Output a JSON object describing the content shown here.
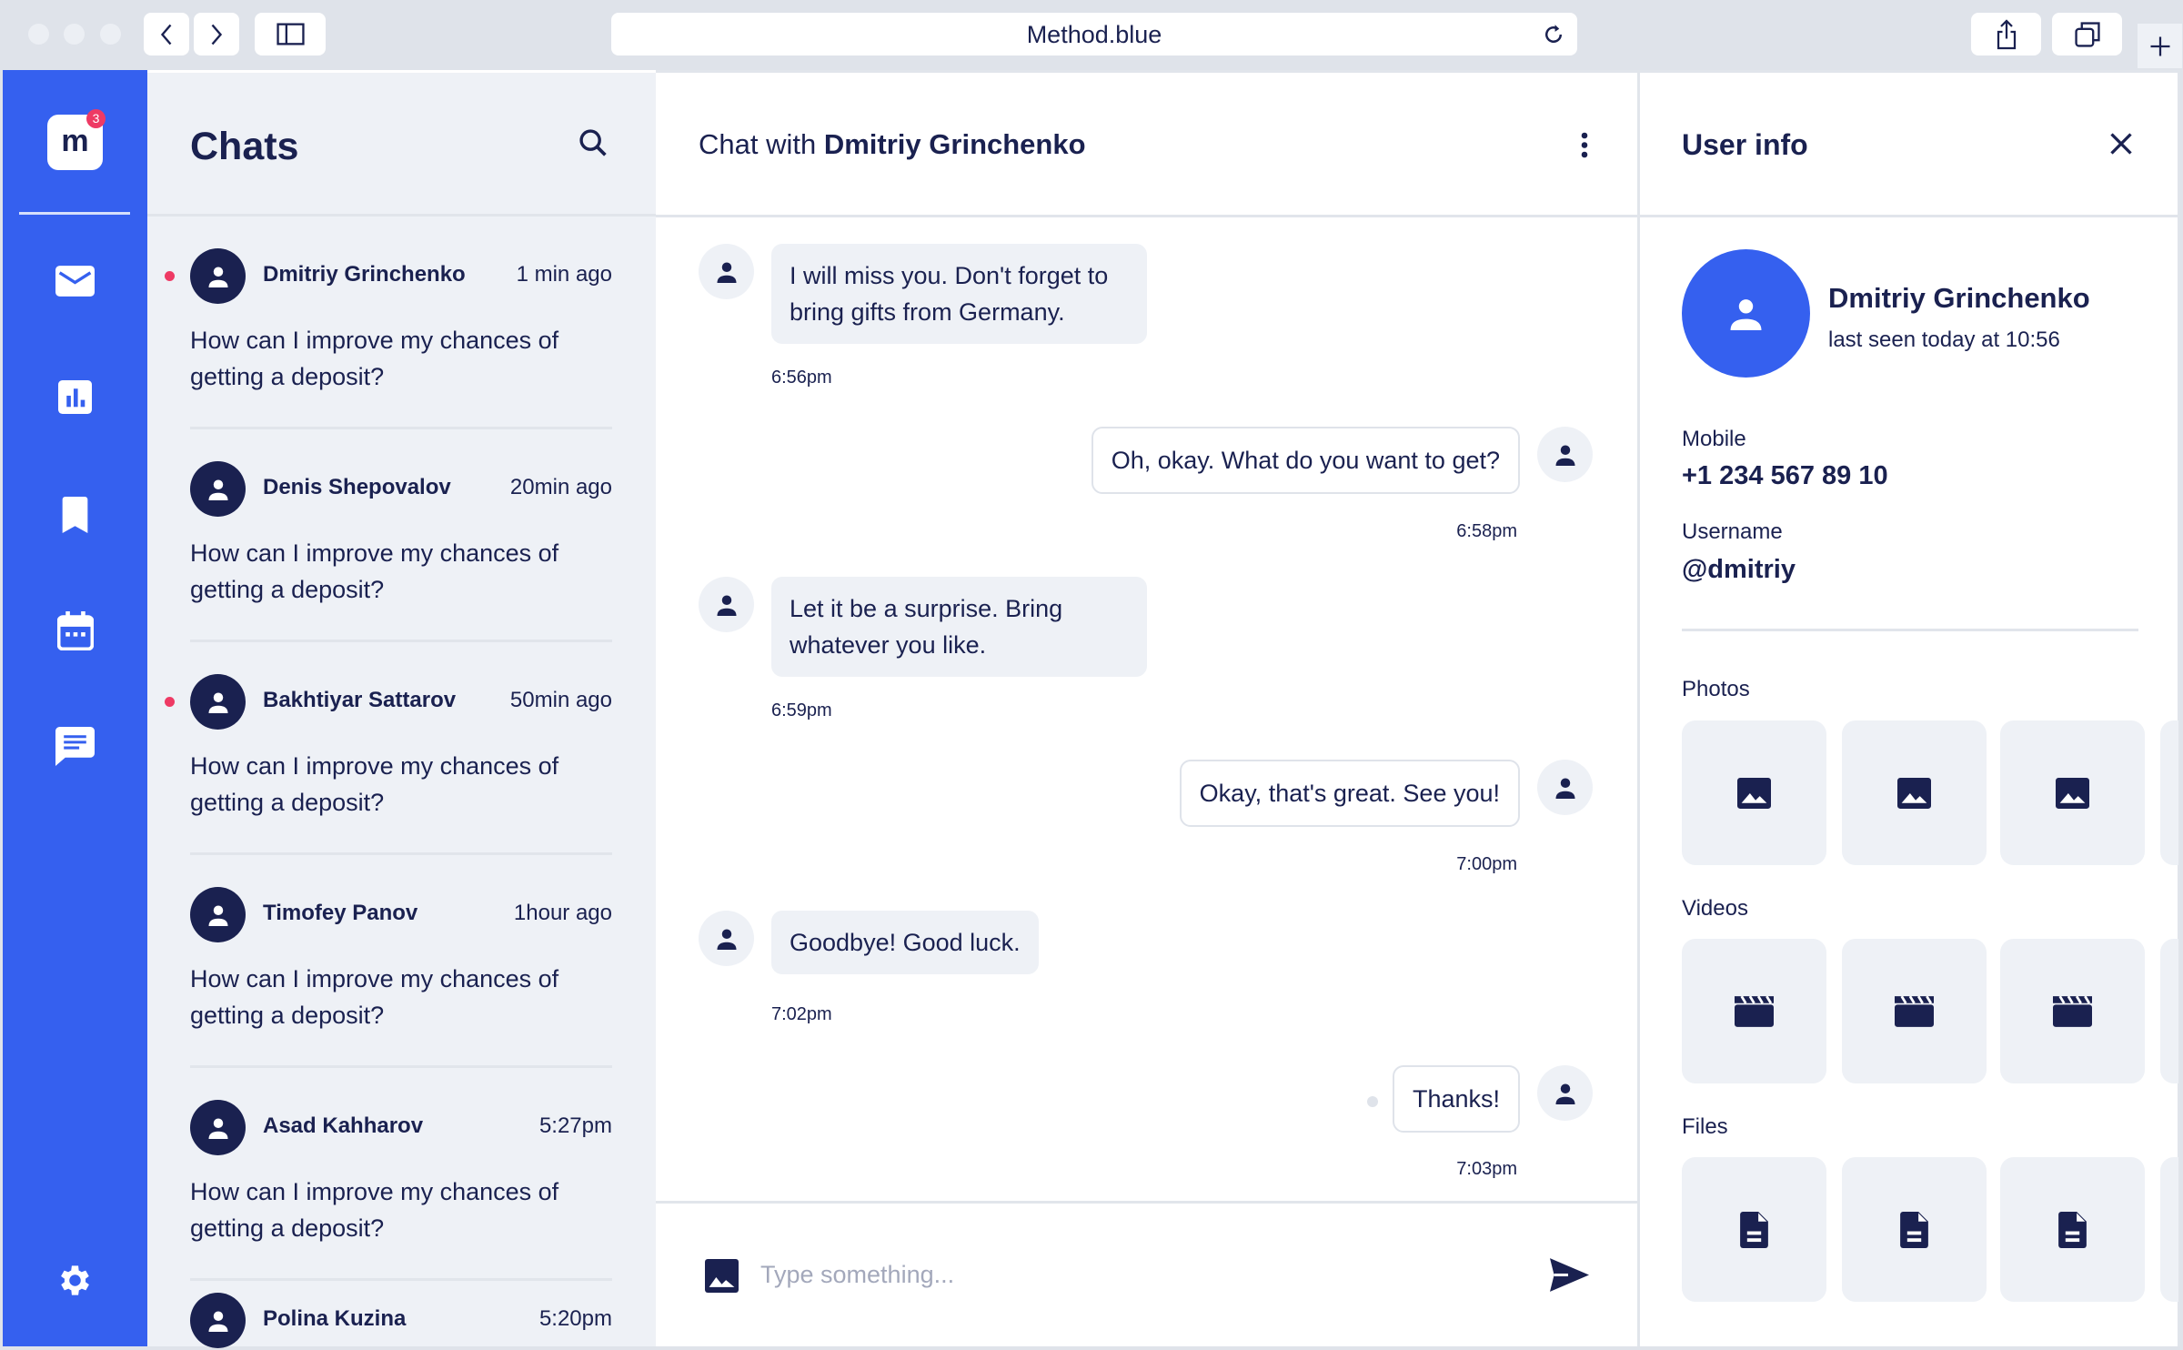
{
  "browser": {
    "url": "Method.blue"
  },
  "app": {
    "logo_letter": "m",
    "notification_count": "3",
    "colors": {
      "accent": "#3560ef",
      "ink": "#1a2150",
      "unread": "#ee3a64",
      "panel": "#eef1f6"
    }
  },
  "sidebar": {
    "items": [
      {
        "name": "mail",
        "icon": "mail-icon"
      },
      {
        "name": "stats",
        "icon": "chart-icon"
      },
      {
        "name": "bookmarks",
        "icon": "bookmark-icon"
      },
      {
        "name": "calendar",
        "icon": "calendar-icon"
      },
      {
        "name": "messages",
        "icon": "chat-icon"
      }
    ],
    "settings_icon": "gear-icon"
  },
  "chats": {
    "title": "Chats",
    "items": [
      {
        "name": "Dmitriy Grinchenko",
        "time": "1 min ago",
        "message": "How can I improve my chances of getting a deposit?",
        "unread": true
      },
      {
        "name": "Denis Shepovalov",
        "time": "20min ago",
        "message": "How can I improve my chances of getting a deposit?",
        "unread": false
      },
      {
        "name": "Bakhtiyar Sattarov",
        "time": "50min ago",
        "message": "How can I improve my chances of getting a deposit?",
        "unread": true
      },
      {
        "name": "Timofey Panov",
        "time": "1hour ago",
        "message": "How can I improve my chances of getting a deposit?",
        "unread": false
      },
      {
        "name": "Asad Kahharov",
        "time": "5:27pm",
        "message": "How can I improve my chances of getting a deposit?",
        "unread": false
      },
      {
        "name": "Polina Kuzina",
        "time": "5:20pm",
        "message": "",
        "unread": false
      }
    ]
  },
  "conversation": {
    "title_prefix": "Chat with",
    "title_name": "Dmitriy Grinchenko",
    "messages": [
      {
        "dir": "in",
        "text": "I will miss you. Don't forget to bring gifts from Germany.",
        "time": "6:56pm"
      },
      {
        "dir": "out",
        "text": "Oh, okay. What do you want to get?",
        "time": "6:58pm"
      },
      {
        "dir": "in",
        "text": "Let it be a surprise. Bring whatever you like.",
        "time": "6:59pm"
      },
      {
        "dir": "out",
        "text": "Okay, that's great. See you!",
        "time": "7:00pm"
      },
      {
        "dir": "in",
        "text": "Goodbye! Good luck.",
        "time": "7:02pm"
      },
      {
        "dir": "out",
        "text": "Thanks!",
        "time": "7:03pm"
      }
    ],
    "input_placeholder": "Type something..."
  },
  "user_info": {
    "title": "User info",
    "name": "Dmitriy Grinchenko",
    "last_seen": "last seen today at 10:56",
    "mobile_label": "Mobile",
    "mobile": "+1 234 567 89 10",
    "username_label": "Username",
    "username": "@dmitriy",
    "photos_label": "Photos",
    "videos_label": "Videos",
    "files_label": "Files"
  }
}
